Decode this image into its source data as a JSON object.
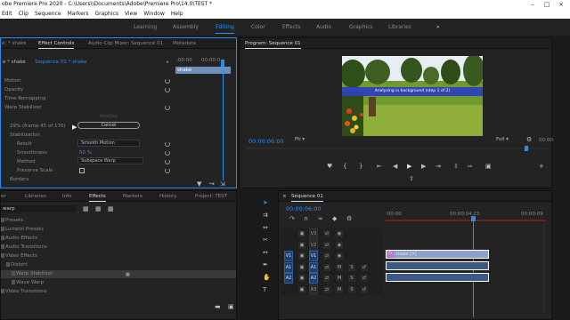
{
  "app": {
    "title": "obe Premiere Pro 2020 - C:\\Users\\\\Documents\\Adobe\\Premiere Pro\\14.0\\TEST *"
  },
  "menu": [
    "Edit",
    "Clip",
    "Sequence",
    "Markers",
    "Graphics",
    "View",
    "Window",
    "Help"
  ],
  "workspaces": {
    "items": [
      "Learning",
      "Assembly",
      "Editing",
      "Color",
      "Effects",
      "Audio",
      "Graphics",
      "Libraries"
    ],
    "active": "Editing",
    "more": "»"
  },
  "effect_controls": {
    "tabs": [
      "e: * shake",
      "Effect Controls",
      "Audio Clip Mixer: Sequence 01",
      "Metadata"
    ],
    "header_master": "e * shake",
    "header_seq": "Sequence 01 * shake",
    "time_start": ":00:00",
    "time_mid": "00:00:0",
    "clip_name": "shake",
    "props": [
      "Motion",
      "Opacity",
      "Time Remapping",
      "Warp Stabilizer"
    ],
    "analyze_label": "Analyze",
    "progress_text": "29% (frame 45 of 170)",
    "cancel_label": "Cancel",
    "stabilization_label": "Stabilization",
    "result_label": "Result",
    "result_value": "Smooth Motion",
    "smoothness_label": "Smoothness",
    "smoothness_value": "50 %",
    "method_label": "Method",
    "method_value": "Subspace Warp",
    "preserve_scale_label": "Preserve Scale",
    "borders_label": "Borders"
  },
  "program": {
    "title": "Program: Sequence 01",
    "banner": "Analyzing in background (step 1 of 2)",
    "timecode": "00:00:06:00",
    "fit": "Fit",
    "quality": "Full",
    "end_time": "00:00:"
  },
  "effects_panel": {
    "tabs": [
      "er",
      "Libraries",
      "Info",
      "Effects",
      "Markers",
      "History",
      "Project: TEST"
    ],
    "active_tab": "Effects",
    "search_value": "warp",
    "tree": [
      {
        "label": "Presets",
        "indent": 0,
        "selected": false
      },
      {
        "label": "Lumetri Presets",
        "indent": 0,
        "selected": false
      },
      {
        "label": "Audio Effects",
        "indent": 0,
        "selected": false
      },
      {
        "label": "Audio Transitions",
        "indent": 0,
        "selected": false
      },
      {
        "label": "Video Effects",
        "indent": 0,
        "selected": false
      },
      {
        "label": "Distort",
        "indent": 1,
        "selected": false
      },
      {
        "label": "Warp Stabilizer",
        "indent": 2,
        "selected": true
      },
      {
        "label": "Wave Warp",
        "indent": 2,
        "selected": false
      },
      {
        "label": "Video Transitions",
        "indent": 0,
        "selected": false
      }
    ]
  },
  "timeline": {
    "tab": "Sequence 01",
    "timecode": "00:00:06:00",
    "ruler": [
      ":00:00",
      "00:00:04:23",
      "00:00:09"
    ],
    "tracks": [
      {
        "name": "V3",
        "src": "",
        "type": "video"
      },
      {
        "name": "V2",
        "src": "",
        "type": "video"
      },
      {
        "name": "V1",
        "src": "V1",
        "type": "video"
      },
      {
        "name": "A1",
        "src": "A1",
        "type": "audio"
      },
      {
        "name": "A2",
        "src": "A2",
        "type": "audio"
      },
      {
        "name": "A3",
        "src": "",
        "type": "audio"
      }
    ],
    "video_clip": "shake [V]",
    "fx_badge": "fx",
    "mute": "M",
    "solo": "S"
  },
  "colors": {
    "accent": "#2d8ceb",
    "panel": "#232323",
    "banner": "#2c3fbf"
  }
}
